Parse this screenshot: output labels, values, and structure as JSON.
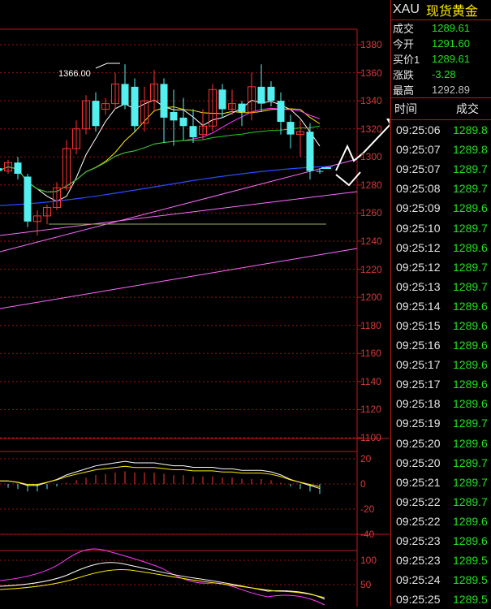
{
  "quote": {
    "symbol": "XAU",
    "name": "现货黄金",
    "rows": [
      {
        "label": "成交",
        "value": "1289.61"
      },
      {
        "label": "今开",
        "value": "1291.60"
      },
      {
        "label": "买价1",
        "value": "1289.61"
      },
      {
        "label": "涨跌",
        "value": "-3.28"
      },
      {
        "label": "最高",
        "value": "1292.89"
      }
    ]
  },
  "ticks": {
    "header_time": "时间",
    "header_price": "成交",
    "rows": [
      {
        "time": "09:25:06",
        "price": "1289.8"
      },
      {
        "time": "09:25:07",
        "price": "1289.8"
      },
      {
        "time": "09:25:07",
        "price": "1289.7"
      },
      {
        "time": "09:25:08",
        "price": "1289.7"
      },
      {
        "time": "09:25:09",
        "price": "1289.6"
      },
      {
        "time": "09:25:10",
        "price": "1289.7"
      },
      {
        "time": "09:25:12",
        "price": "1289.6"
      },
      {
        "time": "09:25:12",
        "price": "1289.7"
      },
      {
        "time": "09:25:13",
        "price": "1289.7"
      },
      {
        "time": "09:25:14",
        "price": "1289.6"
      },
      {
        "time": "09:25:15",
        "price": "1289.6"
      },
      {
        "time": "09:25:16",
        "price": "1289.6"
      },
      {
        "time": "09:25:17",
        "price": "1289.6"
      },
      {
        "time": "09:25:17",
        "price": "1289.6"
      },
      {
        "time": "09:25:18",
        "price": "1289.6"
      },
      {
        "time": "09:25:19",
        "price": "1289.7"
      },
      {
        "time": "09:25:20",
        "price": "1289.6"
      },
      {
        "time": "09:25:20",
        "price": "1289.7"
      },
      {
        "time": "09:25:21",
        "price": "1289.7"
      },
      {
        "time": "09:25:22",
        "price": "1289.7"
      },
      {
        "time": "09:25:22",
        "price": "1289.6"
      },
      {
        "time": "09:25:23",
        "price": "1289.6"
      },
      {
        "time": "09:25:23",
        "price": "1289.5"
      },
      {
        "time": "09:25:24",
        "price": "1289.5"
      },
      {
        "time": "09:25:25",
        "price": "1289.5"
      }
    ]
  },
  "chart_data": {
    "type": "candlestick",
    "annotation": "1366.00",
    "price_axis": {
      "min": 1100,
      "max": 1390,
      "ticks": [
        1380,
        1360,
        1340,
        1320,
        1300,
        1280,
        1260,
        1240,
        1220,
        1200,
        1180,
        1160,
        1140,
        1120,
        1100
      ]
    },
    "macd_axis": {
      "min": -40,
      "max": 25,
      "ticks": [
        20,
        0,
        -20,
        -40
      ]
    },
    "kdj_axis": {
      "min": 20,
      "max": 110,
      "ticks": [
        100,
        50
      ]
    },
    "candles": [
      {
        "o": 1292,
        "h": 1296,
        "l": 1286,
        "c": 1290
      },
      {
        "o": 1290,
        "h": 1298,
        "l": 1288,
        "c": 1296
      },
      {
        "o": 1296,
        "h": 1300,
        "l": 1284,
        "c": 1288
      },
      {
        "o": 1286,
        "h": 1288,
        "l": 1250,
        "c": 1254
      },
      {
        "o": 1254,
        "h": 1262,
        "l": 1244,
        "c": 1258
      },
      {
        "o": 1258,
        "h": 1266,
        "l": 1252,
        "c": 1264
      },
      {
        "o": 1264,
        "h": 1282,
        "l": 1262,
        "c": 1278
      },
      {
        "o": 1278,
        "h": 1312,
        "l": 1276,
        "c": 1306
      },
      {
        "o": 1306,
        "h": 1326,
        "l": 1302,
        "c": 1320
      },
      {
        "o": 1320,
        "h": 1344,
        "l": 1316,
        "c": 1340
      },
      {
        "o": 1340,
        "h": 1346,
        "l": 1318,
        "c": 1322
      },
      {
        "o": 1334,
        "h": 1342,
        "l": 1330,
        "c": 1338
      },
      {
        "o": 1338,
        "h": 1360,
        "l": 1334,
        "c": 1352
      },
      {
        "o": 1352,
        "h": 1366,
        "l": 1334,
        "c": 1337
      },
      {
        "o": 1350,
        "h": 1356,
        "l": 1318,
        "c": 1322
      },
      {
        "o": 1324,
        "h": 1350,
        "l": 1318,
        "c": 1340
      },
      {
        "o": 1340,
        "h": 1362,
        "l": 1332,
        "c": 1352
      },
      {
        "o": 1352,
        "h": 1356,
        "l": 1310,
        "c": 1328
      },
      {
        "o": 1332,
        "h": 1348,
        "l": 1308,
        "c": 1326
      },
      {
        "o": 1328,
        "h": 1342,
        "l": 1312,
        "c": 1322
      },
      {
        "o": 1322,
        "h": 1334,
        "l": 1310,
        "c": 1314
      },
      {
        "o": 1316,
        "h": 1334,
        "l": 1312,
        "c": 1322
      },
      {
        "o": 1322,
        "h": 1352,
        "l": 1318,
        "c": 1348
      },
      {
        "o": 1348,
        "h": 1352,
        "l": 1328,
        "c": 1334
      },
      {
        "o": 1334,
        "h": 1348,
        "l": 1330,
        "c": 1338
      },
      {
        "o": 1338,
        "h": 1340,
        "l": 1322,
        "c": 1332
      },
      {
        "o": 1332,
        "h": 1360,
        "l": 1326,
        "c": 1350
      },
      {
        "o": 1350,
        "h": 1366,
        "l": 1332,
        "c": 1338
      },
      {
        "o": 1350,
        "h": 1354,
        "l": 1336,
        "c": 1340
      },
      {
        "o": 1340,
        "h": 1346,
        "l": 1316,
        "c": 1325
      },
      {
        "o": 1325,
        "h": 1330,
        "l": 1306,
        "c": 1316
      },
      {
        "o": 1316,
        "h": 1326,
        "l": 1300,
        "c": 1318
      },
      {
        "o": 1318,
        "h": 1324,
        "l": 1284,
        "c": 1290
      },
      {
        "o": 1290,
        "h": 1292,
        "l": 1288,
        "c": 1289.6
      }
    ],
    "macd_hist": [
      -3,
      -3,
      -4,
      -6,
      -6,
      -4,
      -2,
      1,
      3,
      5,
      7,
      8,
      9,
      10,
      9,
      9,
      9,
      8,
      7,
      7,
      6,
      6,
      6,
      5,
      5,
      4,
      4,
      4,
      3,
      1,
      -2,
      -4,
      -6,
      -8
    ]
  }
}
